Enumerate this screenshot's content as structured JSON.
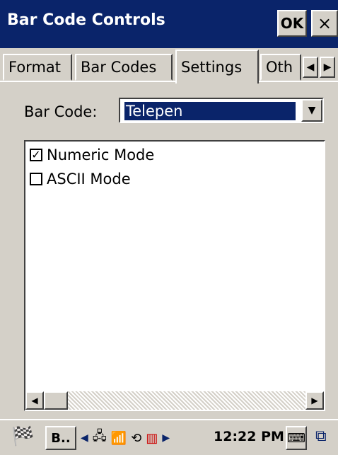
{
  "window": {
    "title": "Bar Code Controls",
    "ok_label": "OK",
    "close_label": "×"
  },
  "tabs": [
    {
      "label": "Format",
      "active": false
    },
    {
      "label": "Bar Codes",
      "active": false
    },
    {
      "label": "Settings",
      "active": true
    },
    {
      "label": "Oth",
      "active": false
    }
  ],
  "tab_scroll": {
    "left": "◀",
    "right": "▶"
  },
  "barcode": {
    "label": "Bar Code:",
    "selected": "Telepen",
    "arrow": "▼"
  },
  "options": [
    {
      "label": "Numeric Mode",
      "checked": true,
      "mark": "✓"
    },
    {
      "label": "ASCII Mode",
      "checked": false,
      "mark": ""
    }
  ],
  "hscroll": {
    "left": "◀",
    "right": "▶"
  },
  "taskbar": {
    "start_icon": "windows-flag-icon",
    "start_glyph": "🏁",
    "task_label": "B..",
    "tray_arrow": "◀",
    "tray_icons": [
      "network-icon",
      "signal-icon",
      "sync-icon",
      "barcode-icon"
    ],
    "tray_glyphs": [
      "🖧",
      "📶",
      "⟲",
      "▥"
    ],
    "tray_right_arrow": "▶",
    "clock": "12:22 PM",
    "keyboard_glyph": "⌨",
    "dual_glyph": "⧉"
  },
  "colors": {
    "titlebar": "#0a246a",
    "selection": "#0a246a",
    "face": "#d4d0c8"
  }
}
